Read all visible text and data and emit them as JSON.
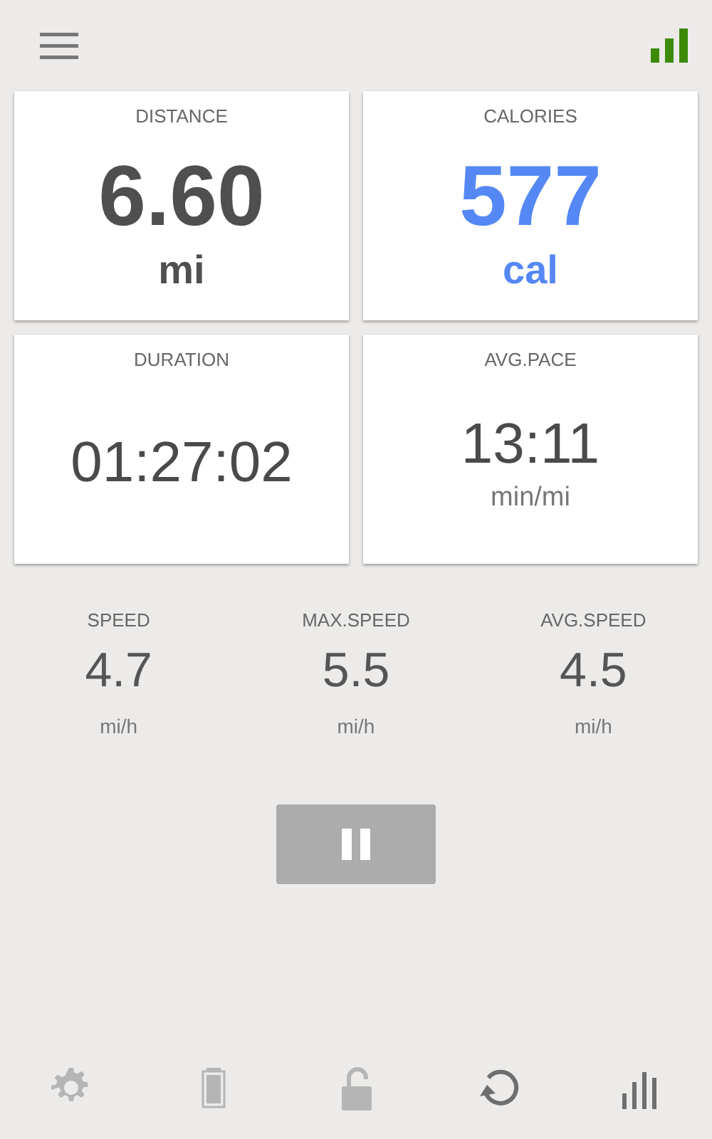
{
  "cards": [
    {
      "label": "DISTANCE",
      "value": "6.60",
      "unit": "mi",
      "kind": "bold"
    },
    {
      "label": "CALORIES",
      "value": "577",
      "unit": "cal",
      "kind": "accent"
    },
    {
      "label": "DURATION",
      "value": "01:27:02",
      "kind": "plain"
    },
    {
      "label": "AVG.PACE",
      "value": "13:11",
      "unit": "min/mi",
      "kind": "plain"
    }
  ],
  "stats": [
    {
      "label": "SPEED",
      "value": "4.7",
      "unit": "mi/h"
    },
    {
      "label": "MAX.SPEED",
      "value": "5.5",
      "unit": "mi/h"
    },
    {
      "label": "AVG.SPEED",
      "value": "4.5",
      "unit": "mi/h"
    }
  ],
  "toolbar": [
    {
      "kind": "settings",
      "active": false
    },
    {
      "kind": "battery",
      "active": false
    },
    {
      "kind": "lock",
      "active": false
    },
    {
      "kind": "refresh",
      "active": true
    },
    {
      "kind": "chart",
      "active": true
    }
  ]
}
